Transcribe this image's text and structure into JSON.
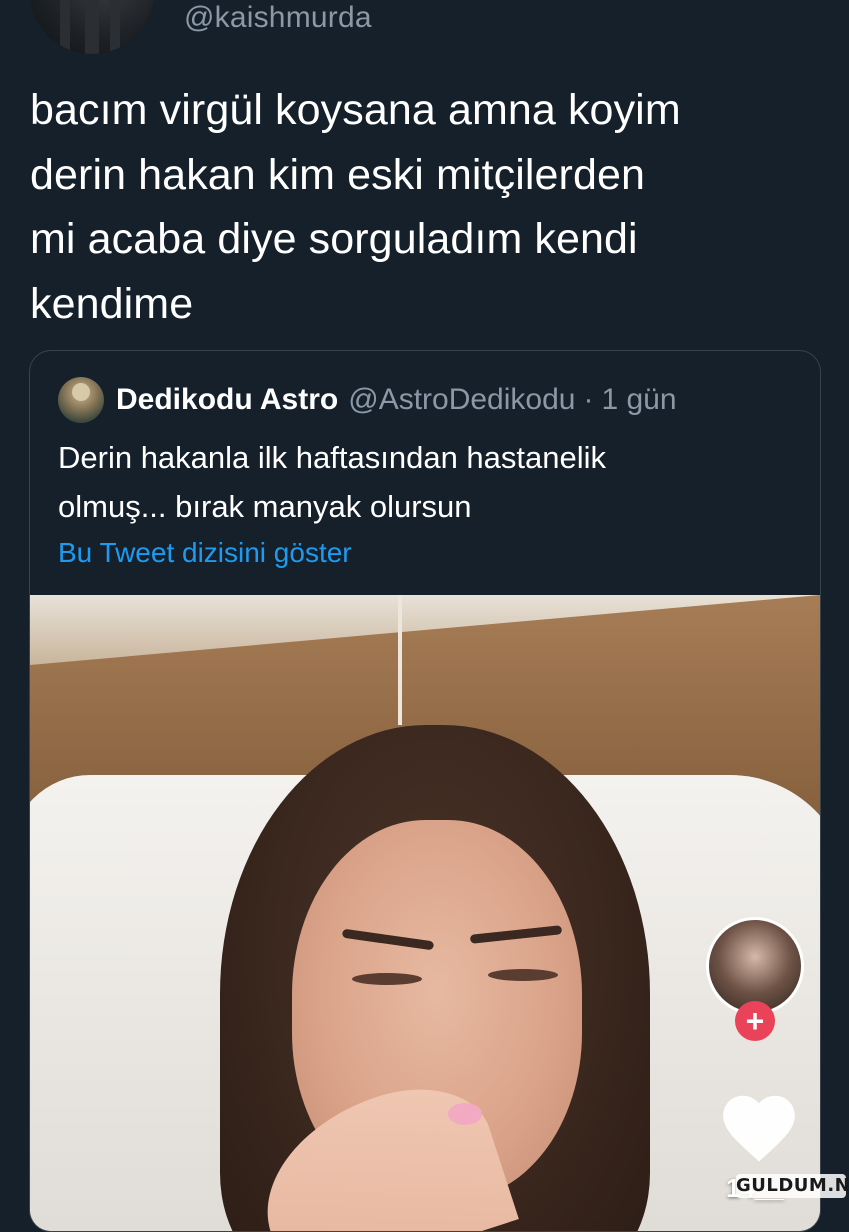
{
  "author": {
    "handle": "@kaishmurda"
  },
  "tweet": {
    "text_lines": [
      "bacım virgül koysana amna koyim",
      "derin hakan kim eski mitçilerden",
      "mi acaba diye sorguladım kendi",
      "kendime"
    ]
  },
  "quoted_tweet": {
    "name": "Dedikodu Astro",
    "handle": "@AstroDedikodu",
    "separator": "·",
    "time": "1 gün",
    "text_lines": [
      "Derin hakanla ilk haftasından hastanelik",
      "olmuş... bırak manyak olursun"
    ],
    "thread_link": "Bu Tweet dizisini göster"
  },
  "media_overlay": {
    "follow_symbol": "+",
    "like_count": "14__",
    "icons": [
      "creator-avatar-icon",
      "heart-icon"
    ]
  },
  "watermark": "GULDUM.NET",
  "colors": {
    "background": "#15202b",
    "secondary_text": "#8b98a5",
    "link": "#1d9bf0",
    "border": "#38444d",
    "follow_badge": "#ea4359"
  }
}
